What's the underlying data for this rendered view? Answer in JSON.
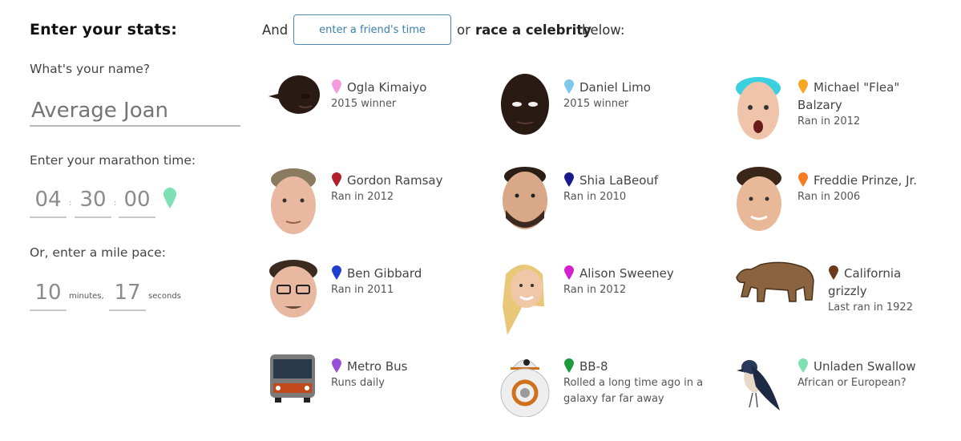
{
  "left": {
    "title": "Enter your stats:",
    "name_label": "What's your name?",
    "name_placeholder": "Average Joan",
    "marathon_label": "Enter your marathon time:",
    "hours": "04",
    "minutes": "30",
    "seconds": "00",
    "colon": ":",
    "pace_label": "Or, enter a mile pace:",
    "pace_minutes": "10",
    "pace_minutes_unit": "minutes,",
    "pace_seconds": "17",
    "pace_seconds_unit": "seconds",
    "pin_color": "#7fe0b4"
  },
  "header": {
    "and_text": "And",
    "friend_button": "enter a friend's time",
    "or_text": "or",
    "race_bold": "race a celebrity",
    "below_text": "below:"
  },
  "celebrities": [
    {
      "name": "Ogla Kimaiyo",
      "sub": "2015 winner",
      "pin": "#f59ae0",
      "icon": "runner-face-icon"
    },
    {
      "name": "Daniel Limo",
      "sub": "2015 winner",
      "pin": "#7ec8ec",
      "icon": "runner-face-icon"
    },
    {
      "name": "Michael \"Flea\" Balzary",
      "sub": "Ran in 2012",
      "pin": "#f5a623",
      "icon": "celebrity-face-icon"
    },
    {
      "name": "Gordon Ramsay",
      "sub": "Ran in 2012",
      "pin": "#b0202a",
      "icon": "celebrity-face-icon"
    },
    {
      "name": "Shia LaBeouf",
      "sub": "Ran in 2010",
      "pin": "#1a1a8c",
      "icon": "celebrity-face-icon"
    },
    {
      "name": "Freddie Prinze, Jr.",
      "sub": "Ran in 2006",
      "pin": "#f57c20",
      "icon": "celebrity-face-icon"
    },
    {
      "name": "Ben Gibbard",
      "sub": "Ran in 2011",
      "pin": "#1f3fd1",
      "icon": "celebrity-face-icon"
    },
    {
      "name": "Alison Sweeney",
      "sub": "Ran in 2012",
      "pin": "#d41fd1",
      "icon": "celebrity-face-icon"
    },
    {
      "name": "California grizzly",
      "sub": "Last ran in 1922",
      "pin": "#6b3a1a",
      "icon": "grizzly-bear-icon"
    },
    {
      "name": "Metro Bus",
      "sub": "Runs daily",
      "pin": "#9b4fd6",
      "icon": "bus-icon"
    },
    {
      "name": "BB-8",
      "sub": "Rolled a long time ago in a galaxy far far away",
      "pin": "#1f9a3a",
      "icon": "bb8-droid-icon"
    },
    {
      "name": "Unladen Swallow",
      "sub": "African or European?",
      "pin": "#7fe0b4",
      "icon": "swallow-bird-icon"
    }
  ]
}
